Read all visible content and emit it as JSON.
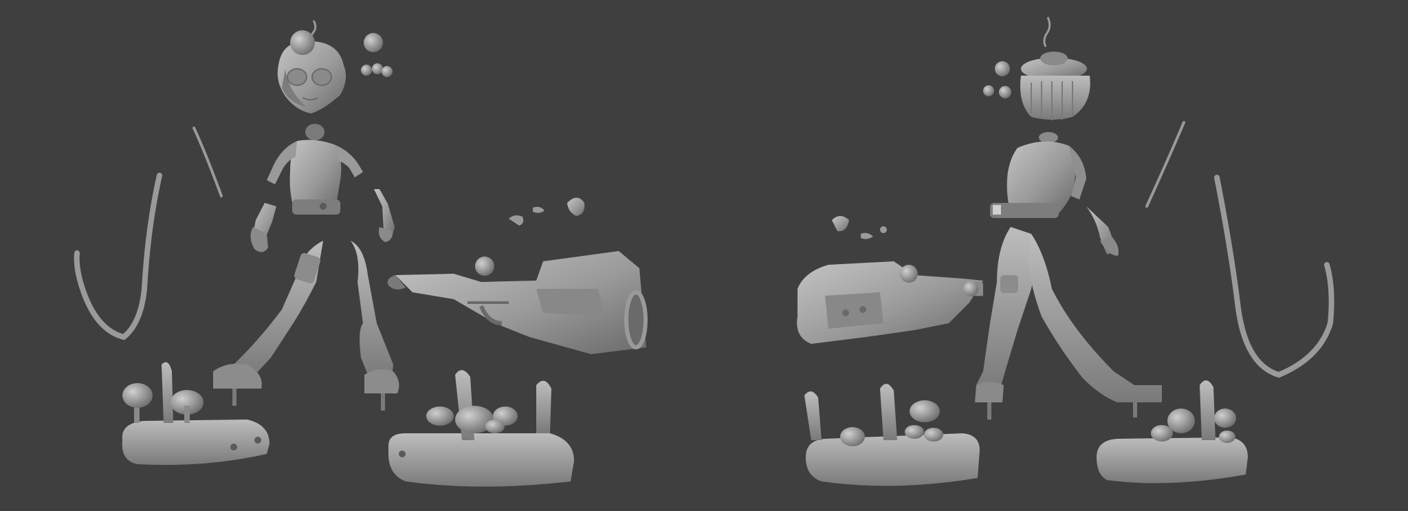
{
  "scene": {
    "background": "#3f3f3f",
    "material": {
      "light": "#b4b4b4",
      "mid": "#8c8c8c",
      "dark": "#5a5a5a",
      "shadow": "#4a4a4a"
    },
    "views": [
      "front-view",
      "back-view"
    ]
  }
}
